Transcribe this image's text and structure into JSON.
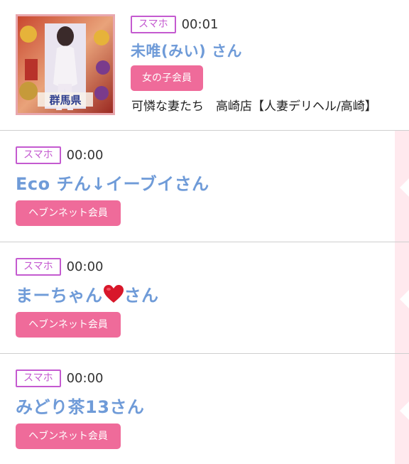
{
  "entries": [
    {
      "device_badge": "スマホ",
      "time": "00:01",
      "name": "未唯(みい) さん",
      "member_label": "女の子会員",
      "shop": "可憐な妻たち　高崎店【人妻デリヘル/高崎】",
      "thumbnail_text": "群馬県"
    },
    {
      "device_badge": "スマホ",
      "time": "00:00",
      "name": "Eco チん↓イーブイさん",
      "member_label": "ヘブンネット会員"
    },
    {
      "device_badge": "スマホ",
      "time": "00:00",
      "name_before": "まーちゃん",
      "name_after": "さん",
      "member_label": "ヘブンネット会員"
    },
    {
      "device_badge": "スマホ",
      "time": "00:00",
      "name": "みどり茶13さん",
      "member_label": "ヘブンネット会員"
    }
  ],
  "colors": {
    "badge_border": "#c45ad0",
    "name_text": "#6f9bd8",
    "member_button": "#ef6b9a",
    "side_strip": "#ffe9ee"
  }
}
